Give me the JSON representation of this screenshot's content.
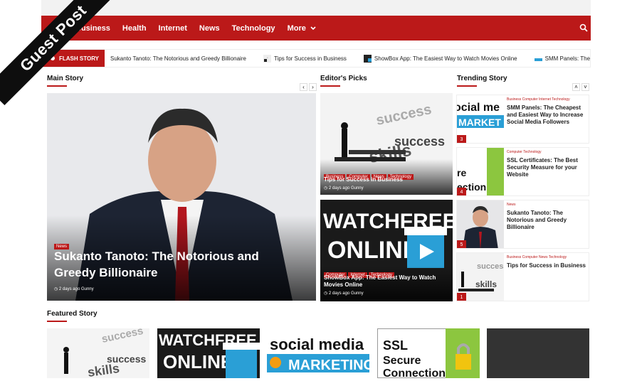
{
  "banner": {
    "text": "Guest Post"
  },
  "nav": {
    "items": [
      "Business",
      "Health",
      "Internet",
      "News",
      "Technology",
      "More"
    ],
    "more_chevron": "⌄"
  },
  "flash": {
    "label": "FLASH STORY",
    "items": [
      "Sukanto Tanoto: The Notorious and Greedy Billionaire",
      "Tips for Success in Business",
      "ShowBox App: The Easiest Way to Watch Movies Online",
      "SMM Panels: The Cheapest and Easiest Way to Increase Social Media Followers"
    ]
  },
  "sections": {
    "main": "Main Story",
    "editors": "Editor's Picks",
    "trending": "Trending Story",
    "featured": "Featured Story"
  },
  "main_story": {
    "tag": "News",
    "title": "Sukanto Tanoto: The Notorious and Greedy Billionaire",
    "time": "2 days ago",
    "author": "Gunny"
  },
  "editors_picks": [
    {
      "tags": [
        "Business",
        "Computer",
        "News",
        "Technology"
      ],
      "title": "Tips for Success in Business",
      "time": "2 days ago",
      "author": "Gunny",
      "image_text": [
        "success",
        "success",
        "skills"
      ]
    },
    {
      "tags": [
        "Computer",
        "Internet",
        "Technology"
      ],
      "title": "ShowBox App: The Easiest Way to Watch Movies Online",
      "time": "2 days ago",
      "author": "Gunny",
      "image_text": [
        "WATCHFREE",
        "ONLINE"
      ]
    }
  ],
  "trending": [
    {
      "num": "3",
      "cats": "Business  Computer  Internet  Technology",
      "title": "SMM Panels: The Cheapest and Easiest Way to Increase Social Media Followers",
      "image_text": [
        "ocial me",
        "MARKET"
      ]
    },
    {
      "num": "4",
      "cats": "Computer  Technology",
      "title": "SSL Certificates: The Best Security Measure for your Website",
      "image_text": [
        "re",
        "ection"
      ]
    },
    {
      "num": "5",
      "cats": "News",
      "title": "Sukanto Tanoto: The Notorious and Greedy Billionaire",
      "image_text": []
    },
    {
      "num": "1",
      "cats": "Business  Computer  News  Technology",
      "title": "Tips for Success in Business",
      "image_text": [
        "success",
        "skills"
      ]
    }
  ],
  "featured": [
    {
      "image_text": [
        "success",
        "success",
        "skills"
      ]
    },
    {
      "image_text": [
        "WATCHFREE",
        "ONLINE"
      ]
    },
    {
      "image_text": [
        "social media",
        "MARKETING"
      ]
    },
    {
      "image_text": [
        "SSL",
        "Secure",
        "Connection"
      ]
    },
    {
      "image_text": []
    }
  ],
  "colors": {
    "brand": "#bb1919",
    "nav_text": "#ffffff",
    "banner": "#0e0e0e"
  },
  "icons": {
    "search": "search-icon",
    "prev": "chevron-left-icon",
    "next": "chevron-right-icon",
    "up": "chevron-up-icon",
    "down": "chevron-down-icon",
    "clock": "clock-icon",
    "user": "user-icon"
  }
}
